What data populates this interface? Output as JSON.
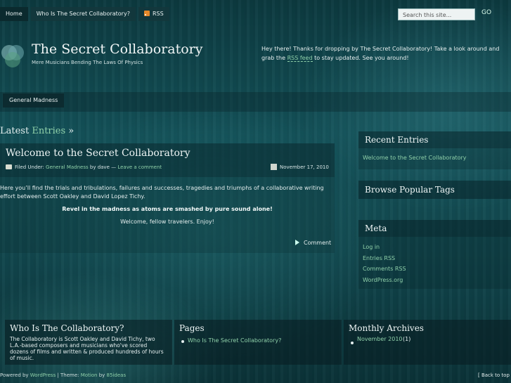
{
  "nav": {
    "home": "Home",
    "who": "Who Is The Secret Collaboratory?",
    "rss": "RSS"
  },
  "search": {
    "placeholder": "Search this site...",
    "go": "GO"
  },
  "site": {
    "title": "The Secret Collaboratory",
    "tagline": "Mere Musicians Bending The Laws Of Physics"
  },
  "welcome": {
    "text_before": "Hey there! Thanks for dropping by The Secret Collaboratory! Take a look around and grab the ",
    "link": "RSS feed",
    "text_after": " to stay updated. See you around!"
  },
  "categories": {
    "general": "General Madness"
  },
  "latest": {
    "prefix": "Latest ",
    "em": "Entries",
    "suffix": " »"
  },
  "post": {
    "title": "Welcome to the Secret Collaboratory",
    "filed_under": "Filed Under: ",
    "category": "General Madness",
    "by": " by dave — ",
    "leave_comment": "Leave a comment",
    "date": "November 17, 2010",
    "para1": "Here you’ll find the trials and tribulations, failures and successes, tragedies and triumphs of a collaborative writing effort between Scott Oakley and David Lopez Tichy.",
    "para2": "Revel in the madness as atoms are smashed by pure sound alone!",
    "para3": "Welcome, fellow travelers.  Enjoy!",
    "comment": "Comment"
  },
  "sidebar": {
    "recent_title": "Recent Entries",
    "recent_item": "Welcome to the Secret Collaboratory",
    "tags_title": "Browse Popular Tags",
    "meta_title": "Meta",
    "meta_items": [
      "Log in",
      "Entries RSS",
      "Comments RSS",
      "WordPress.org"
    ]
  },
  "footer_widgets": {
    "who_title": "Who Is The Collaboratory?",
    "who_text": "The Collaboratory is Scott Oakley and David Tichy, two L.A.-based composers and musicians who've scored dozens of films and written & produced hundreds of hours of music.",
    "pages_title": "Pages",
    "pages_item": "Who Is The Secret Collaboratory?",
    "archives_title": "Monthly Archives",
    "archive_item": "November 2010",
    "archive_count": "(1)"
  },
  "footer": {
    "powered": "Powered by ",
    "wp": "WordPress",
    "theme": " | Theme: ",
    "motion": "Motion",
    "by": " by ",
    "designer": "85ideas",
    "back": "[ Back to top ]"
  },
  "colors": {
    "accent_link": "#8fd0a9",
    "background": "#145259",
    "rss_orange": "#e6892a"
  }
}
